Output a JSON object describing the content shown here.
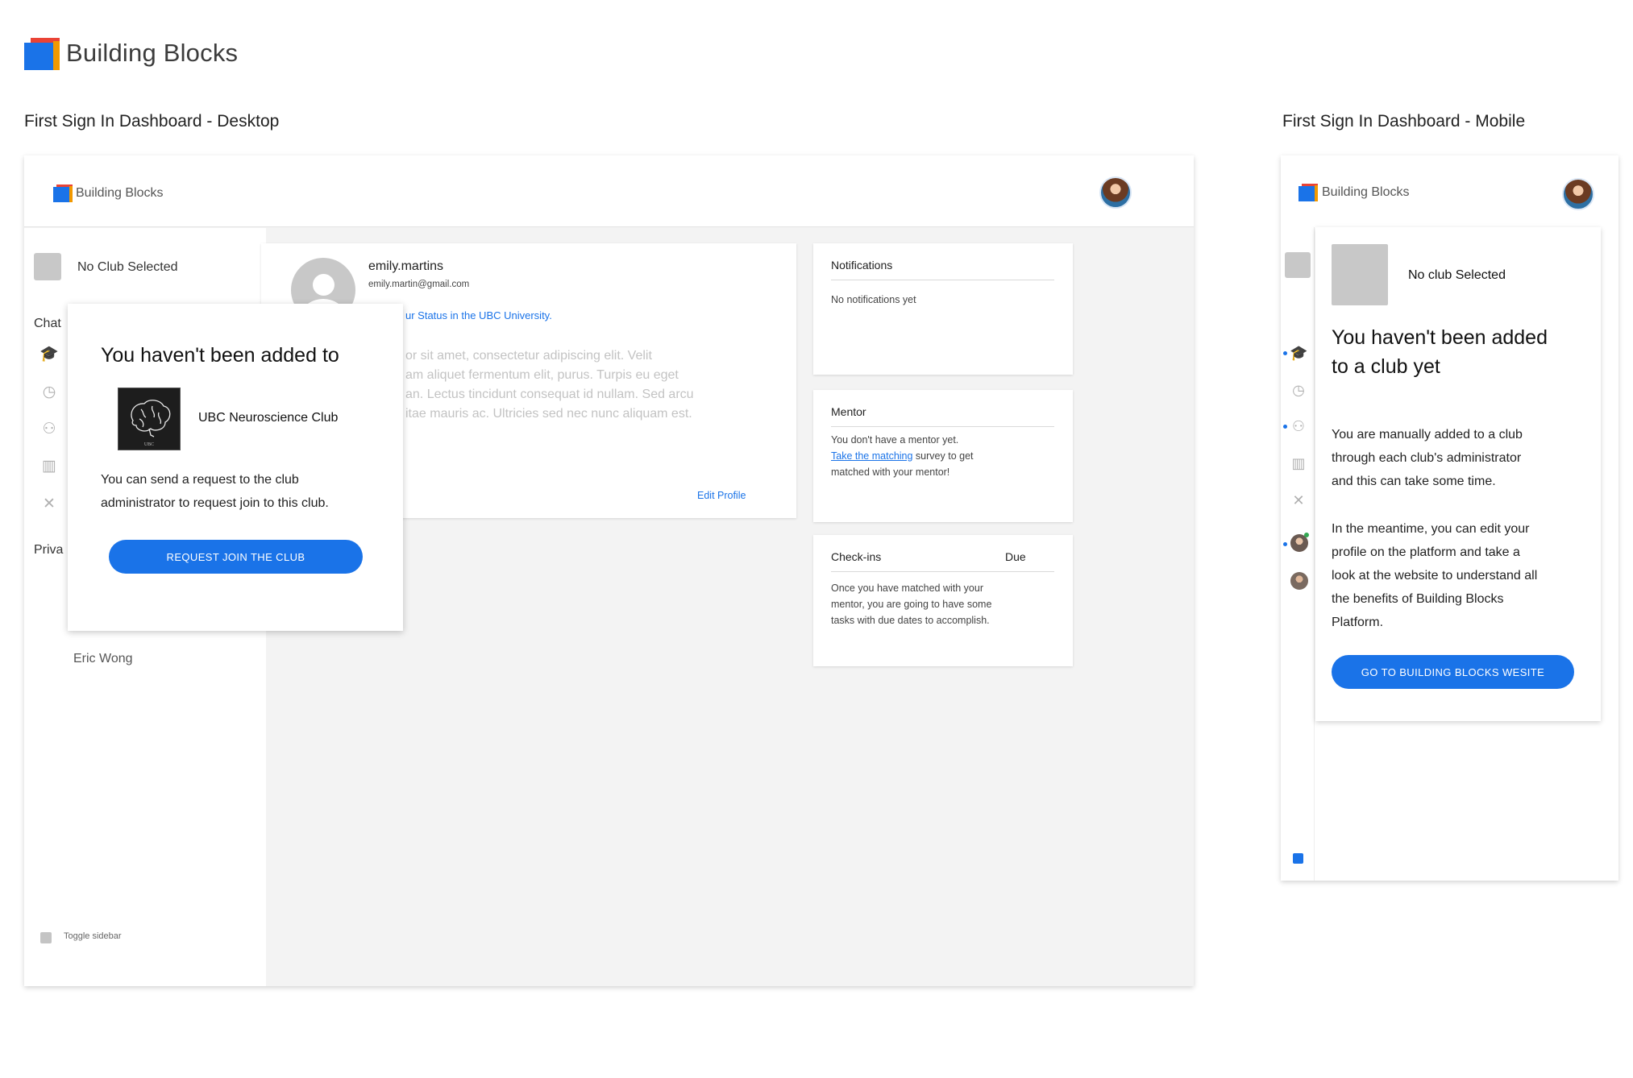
{
  "brand": {
    "name": "Building Blocks"
  },
  "sections": {
    "desktop_title": "First Sign In Dashboard - Desktop",
    "mobile_title": "First Sign In Dashboard - Mobile"
  },
  "desktop": {
    "header": {
      "brand": "Building Blocks"
    },
    "sidebar": {
      "club_selector": "No Club Selected",
      "chat_label": "Chat",
      "private_label": "Priva",
      "contact_name": "Eric Wong",
      "toggle_label": "Toggle sidebar",
      "icons": [
        "graduation-cap-icon",
        "clock-icon",
        "user-check-icon",
        "trash-icon",
        "utensils-icon"
      ]
    },
    "profile": {
      "username": "emily.martins",
      "email": "emily.martin@gmail.com",
      "status_text": "ur Status in the UBC University.",
      "bio_lines": [
        "or sit amet, consectetur adipiscing elit. Velit",
        "am aliquet fermentum elit, purus. Turpis eu eget",
        "an. Lectus tincidunt consequat id nullam. Sed arcu",
        "itae mauris ac. Ultricies sed nec nunc aliquam est."
      ],
      "edit_link": "Edit Profile"
    },
    "notifications": {
      "title": "Notifications",
      "empty": "No notifications yet"
    },
    "mentor": {
      "title": "Mentor",
      "line1": "You don't have a mentor yet.",
      "link": "Take the matching",
      "line2_rest": " survey to get",
      "line3": "matched with your mentor!"
    },
    "checkins": {
      "title": "Check-ins",
      "due_label": "Due",
      "lines": [
        "Once you have matched with your",
        "mentor, you are going to have some",
        "tasks with due dates to accomplish."
      ]
    },
    "popup": {
      "heading": "You haven't been added to",
      "club_name": "UBC Neuroscience Club",
      "club_logo_text": "UBC",
      "body_line1": "You can send a request to the club",
      "body_line2": "administrator to request join to this club.",
      "button": "REQUEST JOIN THE CLUB"
    }
  },
  "mobile": {
    "header": {
      "brand": "Building Blocks"
    },
    "club_selector": "No club Selected",
    "heading_line1": "You haven't been added",
    "heading_line2": "to a club yet",
    "para1": [
      "You are manually added to a club",
      "through each club's administrator",
      "and this can take some time."
    ],
    "para2": [
      "In the meantime, you can edit your",
      "profile on the platform and take a",
      "look at the website to understand all",
      "the benefits of Building Blocks",
      "Platform."
    ],
    "button": "GO TO BUILDING BLOCKS WESITE"
  },
  "colors": {
    "accent": "#1a73e8",
    "cube_front": "#1a73e8",
    "cube_side": "#f29900",
    "cube_top": "#ea4335"
  }
}
